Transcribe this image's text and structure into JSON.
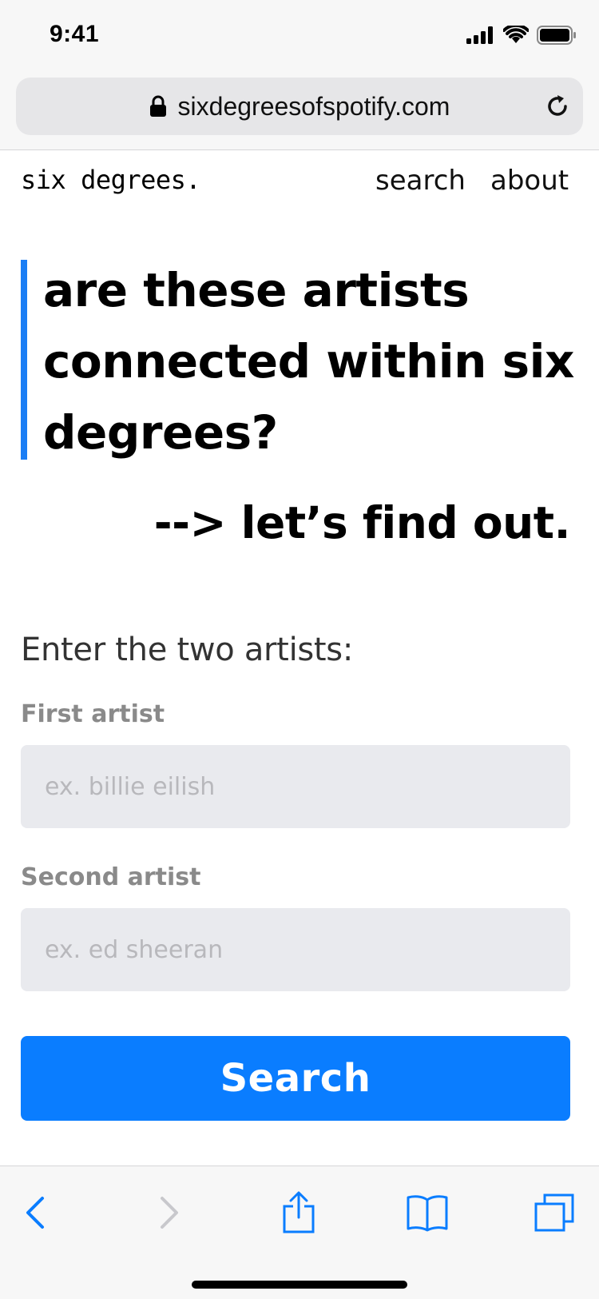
{
  "status_bar": {
    "time": "9:41"
  },
  "browser": {
    "url": "sixdegreesofspotify.com"
  },
  "site_nav": {
    "logo": "six degrees.",
    "links": [
      "search",
      "about"
    ]
  },
  "hero": {
    "headline": "are these artists connected within six degrees?",
    "tagline": "--> let’s find out."
  },
  "form": {
    "heading": "Enter the two artists:",
    "first_label": "First artist",
    "first_placeholder": "ex. billie eilish",
    "first_value": "",
    "second_label": "Second artist",
    "second_placeholder": "ex. ed sheeran",
    "second_value": "",
    "submit_label": "Search"
  },
  "icons": {
    "lock": "lock-icon",
    "reload": "reload-icon",
    "back": "chevron-left-icon",
    "forward": "chevron-right-icon",
    "share": "share-icon",
    "bookmarks": "book-icon",
    "tabs": "tabs-icon"
  },
  "colors": {
    "accent": "#0a7dff",
    "accent_bar": "#1a7ef5",
    "input_bg": "#e9eaee",
    "label_gray": "#8a8a8a",
    "toolbar_bg": "#f7f7f7"
  }
}
